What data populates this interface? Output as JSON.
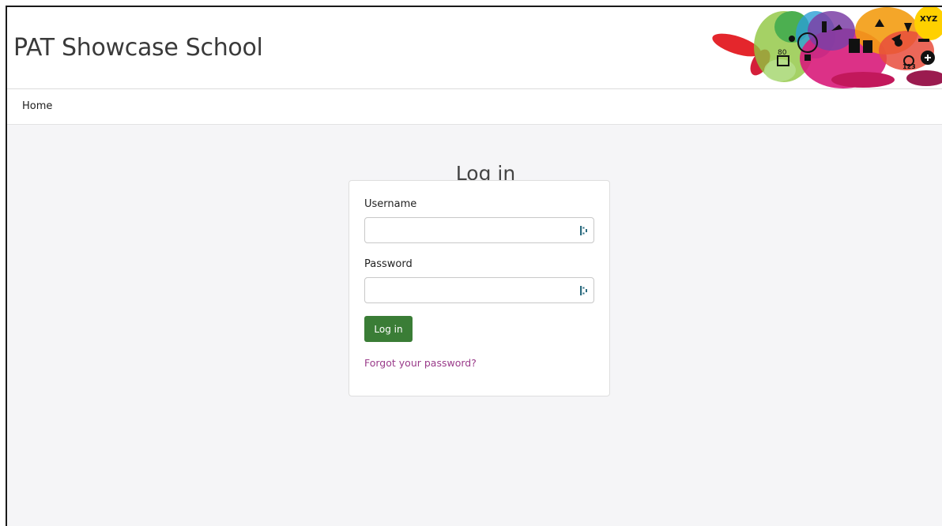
{
  "header": {
    "school_name": "PAT Showcase School"
  },
  "nav": {
    "home_label": "Home"
  },
  "login": {
    "title": "Log in",
    "username_label": "Username",
    "username_value": "",
    "password_label": "Password",
    "password_value": "",
    "submit_label": "Log in",
    "forgot_label": "Forgot your password?"
  },
  "colors": {
    "button": "#3a7d36",
    "link": "#9a3b8a",
    "page_bg": "#f5f5f7"
  },
  "icons": {
    "field_icon": "password-manager-icon",
    "banner": "education-splash-banner"
  }
}
